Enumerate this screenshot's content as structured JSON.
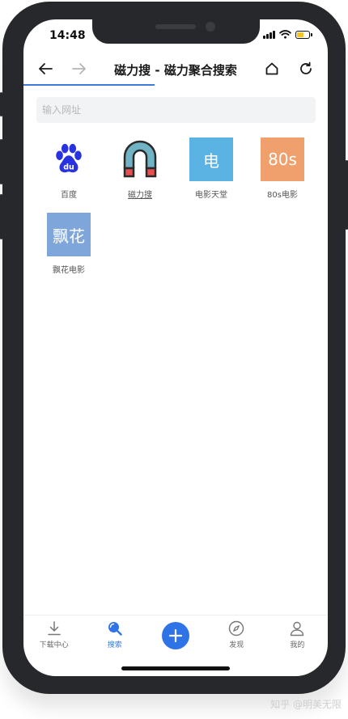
{
  "status_bar": {
    "time": "14:48"
  },
  "navbar": {
    "title": "磁力搜 - 磁力聚合搜索",
    "page_load_progress": 0.43
  },
  "search": {
    "placeholder": "输入网址"
  },
  "sites": [
    {
      "label": "百度",
      "icon": "baidu-paw-icon",
      "bg": "#ffffff"
    },
    {
      "label": "磁力搜",
      "icon": "magnet-icon",
      "bg": "#ffffff"
    },
    {
      "label": "电影天堂",
      "icon_text": "电",
      "bg": "#5bb3e4"
    },
    {
      "label": "80s电影",
      "icon_text": "80s",
      "bg": "#efa06c"
    },
    {
      "label": "飘花电影",
      "icon_text": "飘花",
      "bg": "#7fa6da"
    }
  ],
  "tabbar": [
    {
      "label": "下载中心",
      "icon": "download-icon"
    },
    {
      "label": "搜索",
      "icon": "search-icon",
      "active": true
    },
    {
      "label": "",
      "icon": "add-icon"
    },
    {
      "label": "发现",
      "icon": "compass-icon"
    },
    {
      "label": "我的",
      "icon": "user-icon"
    }
  ],
  "colors": {
    "accent": "#3d7bd9",
    "add_button": "#2f74e6",
    "baidu_blue": "#2932e1",
    "magnet_teal": "#6fb3c4",
    "magnet_red": "#e94f4f"
  },
  "watermark": "知乎 @明美无限"
}
